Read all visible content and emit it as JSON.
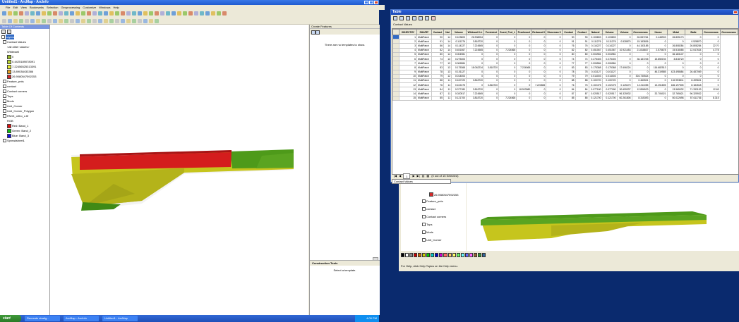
{
  "arcmap": {
    "title": "Untitled1 - ArcMap - ArcInfo",
    "menu": [
      "File",
      "Edit",
      "View",
      "Bookmarks",
      "Selection",
      "Geoprocessing",
      "Customize",
      "Windows",
      "Help"
    ],
    "toc_title": "Table Of Contents",
    "toc_items": [
      {
        "label": "Layers",
        "kind": "group"
      },
      {
        "label": "Contact Values",
        "kind": "layer"
      },
      {
        "label": "<all other values>",
        "kind": "legend"
      },
      {
        "label": "Whitewell",
        "kind": "legend"
      },
      {
        "label": "0",
        "kind": "swatch",
        "color": "#9bbb2a"
      },
      {
        "label": "0.4425189078091",
        "kind": "swatch",
        "color": "#bcd630"
      },
      {
        "label": "7.22456525313391",
        "kind": "swatch",
        "color": "#e6e62a"
      },
      {
        "label": "13.89038433386",
        "kind": "swatch",
        "color": "#e6a020"
      },
      {
        "label": "26.9080547592253",
        "kind": "swatch",
        "color": "#d42a2a"
      },
      {
        "label": "Feature_pnts",
        "kind": "layer"
      },
      {
        "label": "contact",
        "kind": "layer"
      },
      {
        "label": "Contact corners",
        "kind": "layer"
      },
      {
        "label": "Tops",
        "kind": "layer"
      },
      {
        "label": "Mods",
        "kind": "layer"
      },
      {
        "label": "Unit_Corner",
        "kind": "layer"
      },
      {
        "label": "Unit_Corner_Polygon",
        "kind": "layer"
      },
      {
        "label": "PAG3_ortho_c.tif",
        "kind": "layer"
      },
      {
        "label": "RGB",
        "kind": "legend"
      },
      {
        "label": "Red: Band_1",
        "kind": "swatch",
        "color": "#e01010"
      },
      {
        "label": "Green: Band_2",
        "kind": "swatch",
        "color": "#10c010"
      },
      {
        "label": "Blue: Band_3",
        "kind": "swatch",
        "color": "#1010e0"
      },
      {
        "label": "Spreadsheet1",
        "kind": "layer"
      }
    ],
    "create_features_title": "Create Features",
    "create_features_msg": "There are no templates to show.",
    "construction_tools_title": "Construction Tools",
    "construction_tools_msg": "Select a template."
  },
  "taskbar": {
    "start": "start",
    "tasks": [
      "Recreate stratig...",
      "ArcMap - ArcInfo",
      "Untitled1 - ArcMap"
    ],
    "clock": "4:05 PM"
  },
  "attr_table": {
    "title": "Table",
    "tab_label": "Contact Values",
    "columns": [
      "OBJECTID*",
      "SHAPE*",
      "Contact",
      "Nat",
      "Volume",
      "Whitewell Lh",
      "Persistent",
      "Guest_Port_L",
      "Pearlwood",
      "Redwood II",
      "Stoneman II",
      "Contact",
      "Contact",
      "Natural",
      "Volume",
      "Volume",
      "Greenmeans",
      "Hosse",
      "Metal",
      "Balte",
      "Greenmeans",
      "Greenmeans"
    ],
    "rows": [
      [
        "1",
        "MultiPatch",
        "90",
        "14",
        "0.103803",
        "26.908054",
        "0",
        "0",
        "0",
        "0",
        "0",
        "90",
        "90",
        "0.103803",
        "0.103803",
        "0",
        "26.087261",
        "0.448903",
        "26.805173",
        "0",
        "0"
      ],
      [
        "2",
        "MultiPatch",
        "91",
        "14",
        "0.111276",
        "3.818720",
        "0",
        "0",
        "0",
        "0",
        "0",
        "91",
        "91",
        "0.111276",
        "0.111276",
        "0.528870",
        "15.183836",
        "0",
        "0",
        "0.528870",
        "0"
      ],
      [
        "3",
        "MultiPatch",
        "86",
        "14",
        "0.114227",
        "7.224565",
        "0",
        "0",
        "0",
        "0",
        "0",
        "76",
        "76",
        "0.114227",
        "0.114227",
        "0",
        "44.153185",
        "0",
        "26.808284",
        "26.808284",
        "22.70"
      ],
      [
        "4",
        "MultiPatch",
        "82",
        "14",
        "0.451067",
        "7.224565",
        "0",
        "7.224565",
        "0",
        "0",
        "0",
        "82",
        "82",
        "0.451067",
        "0.451067",
        "10.921453",
        "21.818837",
        "2.575678",
        "15.518085",
        "12.047634",
        "4.778"
      ],
      [
        "5",
        "MultiPatch",
        "80",
        "14",
        "0.004981",
        "0",
        "0",
        "0",
        "0",
        "0",
        "0",
        "80",
        "80",
        "0.004981",
        "0.004981",
        "0",
        "0",
        "0",
        "36.183147",
        "0",
        "0"
      ],
      [
        "6",
        "MultiPatch",
        "74",
        "13",
        "0.275403",
        "0",
        "0",
        "0",
        "0",
        "0",
        "0",
        "74",
        "74",
        "0.275403",
        "0.275403",
        "0",
        "36.187245",
        "15.850194",
        "3.818720",
        "0",
        "0"
      ],
      [
        "7",
        "MultiPatch",
        "77",
        "13",
        "0.006584",
        "0",
        "0",
        "0",
        "0",
        "0",
        "0",
        "77",
        "77",
        "0.006584",
        "0.006584",
        "0",
        "0",
        "0",
        "0",
        "0",
        "0"
      ],
      [
        "8",
        "MultiPatch",
        "83",
        "13",
        "0.175368",
        "18.062234",
        "3.818720",
        "0",
        "7.224565",
        "0",
        "0",
        "83",
        "83",
        "0.175368",
        "0.175368",
        "17.606224",
        "0",
        "116.682513",
        "0",
        "0",
        "0"
      ],
      [
        "9",
        "MultiPatch",
        "78",
        "13",
        "0.101127",
        "0",
        "0",
        "0",
        "0",
        "0",
        "0",
        "78",
        "78",
        "0.101127",
        "0.101127",
        "0",
        "0",
        "46.319585",
        "423.498684",
        "26.487069",
        "0"
      ],
      [
        "10",
        "MultiPatch",
        "79",
        "12",
        "0.014003",
        "0",
        "0",
        "0",
        "0",
        "0",
        "0",
        "79",
        "79",
        "0.014003",
        "0.014003",
        "0",
        "304.730524",
        "0",
        "0",
        "0",
        "0"
      ],
      [
        "11",
        "MultiPatch",
        "88",
        "11",
        "0.100720",
        "3.818720",
        "0",
        "0",
        "0",
        "0",
        "0",
        "88",
        "88",
        "0.100720",
        "0.100720",
        "0",
        "0.460501",
        "0",
        "132.993811",
        "8.499601",
        "0"
      ],
      [
        "12",
        "MultiPatch",
        "76",
        "11",
        "0.102475",
        "0",
        "3.818720",
        "0",
        "0",
        "7.224565",
        "0",
        "76",
        "76",
        "0.102475",
        "0.102475",
        "0.125470",
        "12.211055",
        "13.251805",
        "186.197505",
        "8.184518",
        "0"
      ],
      [
        "13",
        "MultiPatch",
        "84",
        "11",
        "0.077180",
        "3.818720",
        "0",
        "0",
        "18.903080",
        "0",
        "0",
        "84",
        "84",
        "0.077180",
        "0.077180",
        "30.699337",
        "12.896523",
        "0",
        "13.965032",
        "71.333193",
        "12.69"
      ],
      [
        "14",
        "MultiPatch",
        "87",
        "11",
        "0.020517",
        "7.224565",
        "0",
        "0",
        "0",
        "0",
        "0",
        "87",
        "87",
        "0.020517",
        "0.020517",
        "96.325932",
        "0",
        "32.706021",
        "32.765621",
        "96.325932",
        "0"
      ],
      [
        "15",
        "MultiPatch",
        "85",
        "11",
        "0.121700",
        "3.818720",
        "0",
        "7.224565",
        "0",
        "0",
        "0",
        "85",
        "85",
        "0.121700",
        "0.121700",
        "60.261806",
        "8.315393",
        "0",
        "50.022698",
        "57.611736",
        "8.315"
      ]
    ],
    "nav_text": "(0 out of 15 Selected)",
    "nav_record": "1",
    "nav_tab": "Contact Values"
  },
  "arcmap2": {
    "toc_items": [
      "Feature_pnts",
      "contact",
      "Contact corners",
      "Tops",
      "Mods",
      "Unit_Corner"
    ],
    "legend_label": "26.9080547592253",
    "status": "For Help, click Help Topics on the Help menu."
  },
  "colors": {
    "xp_blue": "#1f5bd0",
    "surface_red": "#d41d1d",
    "surface_yellow": "#c8c81c",
    "surface_green": "#4e9a1a"
  }
}
